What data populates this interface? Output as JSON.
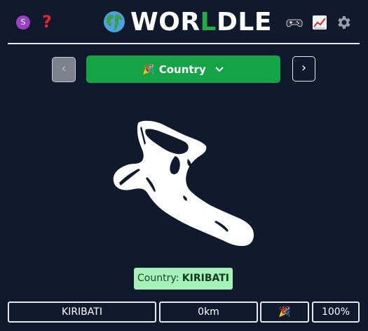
{
  "header": {
    "avatar_letter": "S",
    "help_symbol": "?",
    "title_prefix": "WOR",
    "title_highlight": "L",
    "title_suffix": "DLE",
    "accent_color": "#29a84a"
  },
  "controls": {
    "prev_symbol": "‹",
    "next_symbol": "›",
    "mode_emoji": "🎉",
    "mode_label": "Country"
  },
  "answer": {
    "prefix": "Country: ",
    "value": "KIRIBATI"
  },
  "guess": {
    "country": "KIRIBATI",
    "distance": "0km",
    "direction_emoji": "🎉",
    "proximity": "100%"
  }
}
